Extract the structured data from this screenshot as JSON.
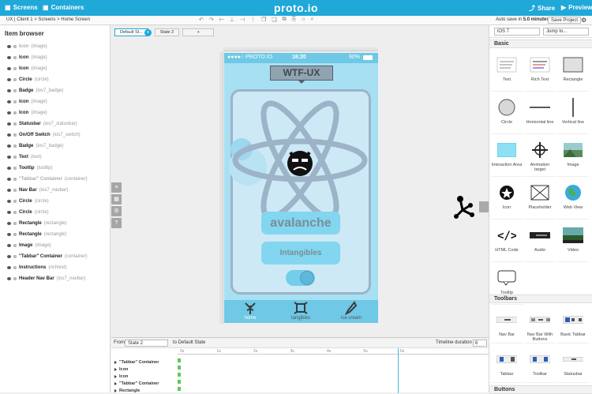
{
  "topbar": {
    "screens_label": "Screens",
    "containers_label": "Containers",
    "logo": "proto.io",
    "share_label": "Share",
    "preview_label": "Preview"
  },
  "subbar": {
    "breadcrumb": "UX | Client 1 > Screens > Home Screen",
    "autosave_prefix": "Auto save in ",
    "autosave_time": "5.0 minutes",
    "save_label": "Save Project"
  },
  "item_browser": {
    "title": "Item browser",
    "items": [
      {
        "name": "Icon",
        "type": "(image)",
        "dim": true
      },
      {
        "name": "Icon",
        "type": "(image)",
        "dim": false
      },
      {
        "name": "Icon",
        "type": "(image)",
        "dim": false
      },
      {
        "name": "Circle",
        "type": "(circle)",
        "dim": false
      },
      {
        "name": "Badge",
        "type": "(ios7_badge)",
        "dim": false
      },
      {
        "name": "Icon",
        "type": "(image)",
        "dim": false
      },
      {
        "name": "Icon",
        "type": "(image)",
        "dim": false
      },
      {
        "name": "Statusbar",
        "type": "(ios7_statusbar)",
        "dim": false
      },
      {
        "name": "On/Off Switch",
        "type": "(ios7_switch)",
        "dim": false
      },
      {
        "name": "Badge",
        "type": "(ios7_badge)",
        "dim": false
      },
      {
        "name": "Text",
        "type": "(text)",
        "dim": false
      },
      {
        "name": "Tooltip",
        "type": "(tooltip)",
        "dim": false
      },
      {
        "name": "\"Tabbar\" Container",
        "type": "(container)",
        "dim": true
      },
      {
        "name": "Nav Bar",
        "type": "(ios7_navbar)",
        "dim": false
      },
      {
        "name": "Circle",
        "type": "(circle)",
        "dim": false
      },
      {
        "name": "Circle",
        "type": "(circle)",
        "dim": false
      },
      {
        "name": "Rectangle",
        "type": "(rectangle)",
        "dim": false
      },
      {
        "name": "Rectangle",
        "type": "(rectangle)",
        "dim": false
      },
      {
        "name": "Image",
        "type": "(image)",
        "dim": false
      },
      {
        "name": "\"Tabbar\" Container",
        "type": "(container)",
        "dim": false
      },
      {
        "name": "Instructions",
        "type": "(richtext)",
        "dim": false
      },
      {
        "name": "Header Nav Bar",
        "type": "(ios7_navbar)",
        "dim": false
      }
    ]
  },
  "canvas": {
    "tabs": [
      {
        "label": "Default St..."
      },
      {
        "label": "State 2"
      },
      {
        "label": "+"
      }
    ],
    "phone": {
      "carrier": "●●●●○ PROTO.IO",
      "time": "16:20",
      "battery": "90%",
      "nav_title": "WTF-UX",
      "button_a": "avalanche",
      "button_b": "Intangibles",
      "tabs": [
        {
          "label": "home"
        },
        {
          "label": "tangibles"
        },
        {
          "label": "ice cream"
        }
      ]
    }
  },
  "timeline": {
    "from_label": "From",
    "from_state": "State 2",
    "to_label": "to Default State",
    "duration_label": "Timeline duration",
    "duration_value": "6",
    "ticks": [
      "0s",
      "1s",
      "2s",
      "3s",
      "4s",
      "5s",
      "6s"
    ],
    "rows": [
      "\"Tabbar\" Container",
      "Icon",
      "Icon",
      "\"Tabbar\" Container",
      "Rectangle"
    ]
  },
  "right_panel": {
    "device": "iOS 7",
    "jump": "Jump to...",
    "basic_title": "Basic",
    "basic_items": [
      {
        "label": "Text",
        "icon": "text-icon"
      },
      {
        "label": "Rich Text",
        "icon": "rich-text-icon"
      },
      {
        "label": "Rectangle",
        "icon": "rectangle-icon"
      },
      {
        "label": "Circle",
        "icon": "circle-icon"
      },
      {
        "label": "Horizontal line",
        "icon": "horizontal-line-icon"
      },
      {
        "label": "Vertical line",
        "icon": "vertical-line-icon"
      },
      {
        "label": "Interaction Area",
        "icon": "interaction-area-icon"
      },
      {
        "label": "Animation target",
        "icon": "animation-target-icon"
      },
      {
        "label": "Image",
        "icon": "image-icon"
      },
      {
        "label": "Icon",
        "icon": "star-icon"
      },
      {
        "label": "Placeholder",
        "icon": "placeholder-icon"
      },
      {
        "label": "Web View",
        "icon": "globe-icon"
      },
      {
        "label": "HTML Code",
        "icon": "code-icon"
      },
      {
        "label": "Audio",
        "icon": "audio-icon"
      },
      {
        "label": "Video",
        "icon": "video-icon"
      },
      {
        "label": "Tooltip",
        "icon": "tooltip-icon"
      }
    ],
    "toolbars_title": "Toolbars",
    "toolbar_items": [
      {
        "label": "Nav Bar",
        "icon": "nav-bar-icon"
      },
      {
        "label": "Nav Bar With Buttons",
        "icon": "nav-bar-buttons-icon"
      },
      {
        "label": "Basic Tabbar",
        "icon": "basic-tabbar-icon"
      },
      {
        "label": "Tabbar",
        "icon": "tabbar-icon"
      },
      {
        "label": "Toolbar",
        "icon": "toolbar-icon"
      },
      {
        "label": "Statusbar",
        "icon": "statusbar-icon"
      }
    ],
    "buttons_title": "Buttons"
  },
  "colors": {
    "brand": "#1fa8d8",
    "phone_bg": "#a7e0f3",
    "button": "#82d6ef"
  }
}
